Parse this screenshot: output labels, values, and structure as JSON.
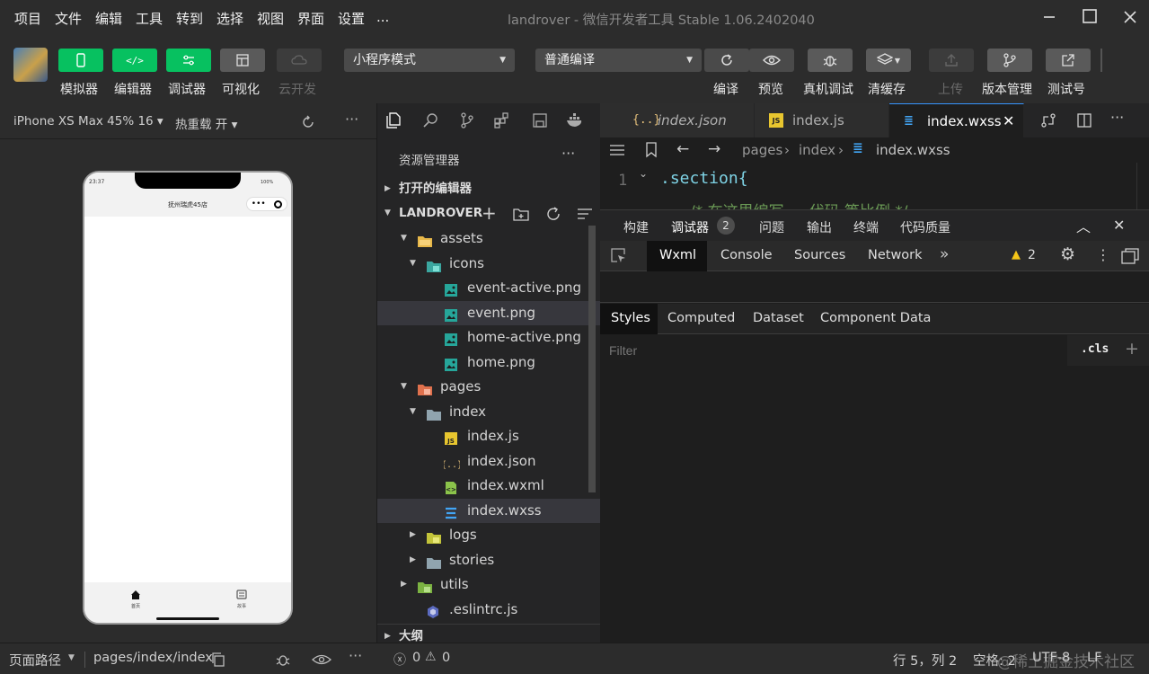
{
  "menubar": {
    "items": [
      "项目",
      "文件",
      "编辑",
      "工具",
      "转到",
      "选择",
      "视图",
      "界面",
      "设置",
      "..."
    ],
    "title_app": "landrover",
    "title_sep": " - ",
    "title_rest": "微信开发者工具 Stable 1.06.2402040"
  },
  "toolbar": {
    "simulator": "模拟器",
    "editor": "编辑器",
    "debugger": "调试器",
    "visual": "可视化",
    "cloud": "云开发",
    "mode_select": "小程序模式",
    "compile_select": "普通编译",
    "compile": "编译",
    "preview": "预览",
    "realdebug": "真机调试",
    "clearcache": "清缓存",
    "upload": "上传",
    "version": "版本管理",
    "test": "测试号"
  },
  "simulator": {
    "device": "iPhone XS Max 45% 16 ▾",
    "hotreload": "热重载 开 ▾",
    "time": "23:37",
    "battery": "100%",
    "nav_title": "抚州瑞虎45店",
    "tab_home": "首页",
    "tab_story": "故事"
  },
  "explorer": {
    "title": "资源管理器",
    "open_editors": "打开的编辑器",
    "project": "LANDROVER",
    "outline": "大纲",
    "items": [
      {
        "label": "assets",
        "depth": 1,
        "kind": "folder-asset",
        "open": true
      },
      {
        "label": "icons",
        "depth": 2,
        "kind": "folder-icons",
        "open": true
      },
      {
        "label": "event-active.png",
        "depth": 3,
        "kind": "image"
      },
      {
        "label": "event.png",
        "depth": 3,
        "kind": "image",
        "selected": true
      },
      {
        "label": "home-active.png",
        "depth": 3,
        "kind": "image"
      },
      {
        "label": "home.png",
        "depth": 3,
        "kind": "image"
      },
      {
        "label": "pages",
        "depth": 1,
        "kind": "folder-pages",
        "open": true
      },
      {
        "label": "index",
        "depth": 2,
        "kind": "folder",
        "open": true
      },
      {
        "label": "index.js",
        "depth": 3,
        "kind": "js"
      },
      {
        "label": "index.json",
        "depth": 3,
        "kind": "json"
      },
      {
        "label": "index.wxml",
        "depth": 3,
        "kind": "wxml"
      },
      {
        "label": "index.wxss",
        "depth": 3,
        "kind": "wxss",
        "selected": true
      },
      {
        "label": "logs",
        "depth": 2,
        "kind": "folder-logs",
        "open": false
      },
      {
        "label": "stories",
        "depth": 2,
        "kind": "folder",
        "open": false
      },
      {
        "label": "utils",
        "depth": 1,
        "kind": "folder-utils",
        "open": false
      },
      {
        "label": ".eslintrc.js",
        "depth": 1,
        "kind": "eslint"
      }
    ]
  },
  "editor": {
    "tabs": [
      {
        "label": "index.json",
        "icon": "{..}"
      },
      {
        "label": "index.js",
        "icon": "JS"
      },
      {
        "label": "index.wxss",
        "icon": "css"
      }
    ],
    "breadcrumb": [
      "pages",
      "index",
      "index.wxss"
    ],
    "line_number": "1",
    "code_line": ".section{",
    "code_line2": "/* 在这里编写 … 代码 等比例 */"
  },
  "devtools": {
    "top_tabs": [
      "构建",
      "调试器",
      "问题",
      "输出",
      "终端",
      "代码质量"
    ],
    "debugger_badge": "2",
    "panel_tabs": [
      "Wxml",
      "Console",
      "Sources",
      "Network"
    ],
    "warn_count": "2",
    "style_tabs": [
      "Styles",
      "Computed",
      "Dataset",
      "Component Data"
    ],
    "filter_placeholder": "Filter",
    "cls": ".cls"
  },
  "status": {
    "path_label": "页面路径",
    "path_value": "pages/index/index",
    "errors": "0",
    "warnings": "0",
    "position": "行 5，列 2",
    "space": "空格: 2",
    "encoding": "UTF-8",
    "eol": "LF",
    "watermark": "@稀土掘金技术社区"
  },
  "colors": {
    "green": "#07c160",
    "accent_blue": "#3794ff"
  }
}
